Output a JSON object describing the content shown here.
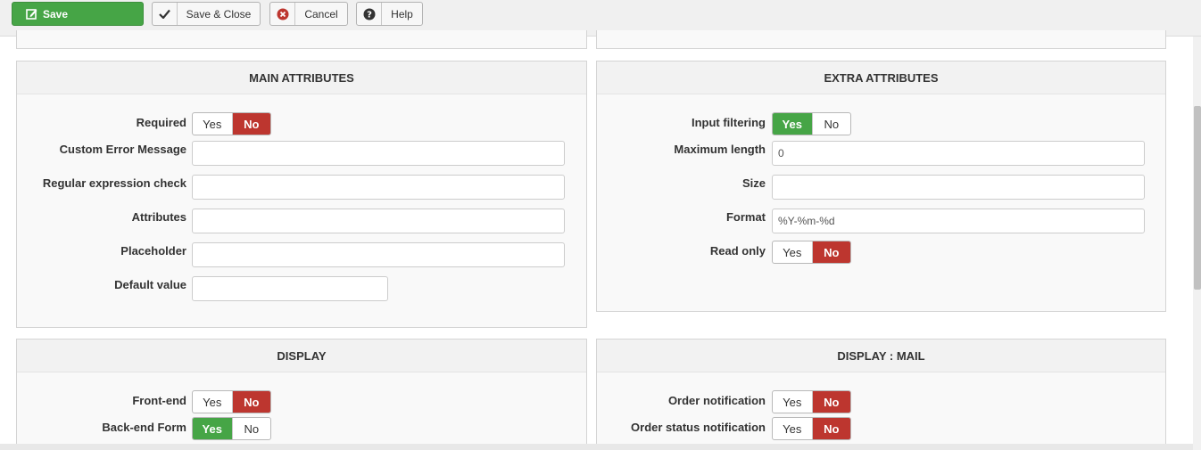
{
  "toolbar": {
    "save": "Save",
    "save_close": "Save & Close",
    "cancel": "Cancel",
    "help": "Help"
  },
  "icons": {
    "save": "edit-save-icon",
    "save_close": "checkmark-icon",
    "cancel": "cancel-circle-icon",
    "help": "question-circle-icon"
  },
  "colors": {
    "save_green": "#46a546",
    "no_red": "#bd362f",
    "yes_green": "#46a546"
  },
  "main_attributes": {
    "title": "MAIN ATTRIBUTES",
    "required": {
      "label": "Required",
      "yes": "Yes",
      "no": "No",
      "selected": "No"
    },
    "custom_error": {
      "label": "Custom Error Message",
      "value": ""
    },
    "regex": {
      "label": "Regular expression check",
      "value": ""
    },
    "attributes": {
      "label": "Attributes",
      "value": ""
    },
    "placeholder": {
      "label": "Placeholder",
      "value": ""
    },
    "default_value": {
      "label": "Default value",
      "value": ""
    }
  },
  "extra_attributes": {
    "title": "EXTRA ATTRIBUTES",
    "input_filtering": {
      "label": "Input filtering",
      "yes": "Yes",
      "no": "No",
      "selected": "Yes"
    },
    "max_length": {
      "label": "Maximum length",
      "value": "0"
    },
    "size": {
      "label": "Size",
      "value": ""
    },
    "format": {
      "label": "Format",
      "value": "%Y-%m-%d"
    },
    "read_only": {
      "label": "Read only",
      "yes": "Yes",
      "no": "No",
      "selected": "No"
    }
  },
  "display": {
    "title": "DISPLAY",
    "front_end": {
      "label": "Front-end",
      "yes": "Yes",
      "no": "No",
      "selected": "No"
    },
    "backend_form": {
      "label": "Back-end Form",
      "yes": "Yes",
      "no": "No",
      "selected": "Yes"
    }
  },
  "display_mail": {
    "title": "DISPLAY : MAIL",
    "order_notification": {
      "label": "Order notification",
      "yes": "Yes",
      "no": "No",
      "selected": "No"
    },
    "order_status_notification": {
      "label": "Order status notification",
      "yes": "Yes",
      "no": "No",
      "selected": "No"
    }
  }
}
